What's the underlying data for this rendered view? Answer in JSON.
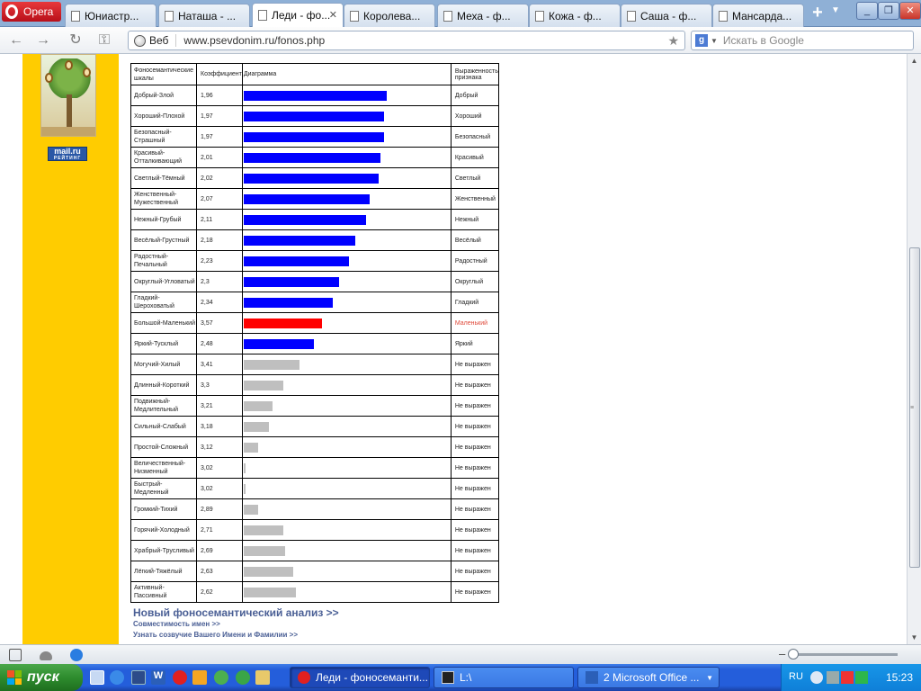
{
  "browser": {
    "menu_label": "Opera",
    "tabs": [
      {
        "title": "Юниастр..."
      },
      {
        "title": "Наташа - ..."
      },
      {
        "title": "Леди - фо..."
      },
      {
        "title": "Королева..."
      },
      {
        "title": "Меха - ф..."
      },
      {
        "title": "Кожа - ф..."
      },
      {
        "title": "Саша - ф..."
      },
      {
        "title": "Мансарда..."
      }
    ],
    "active_tab_index": 2,
    "address": {
      "scope_label": "Веб",
      "url": "www.psevdonim.ru/fonos.php"
    },
    "search": {
      "engine_icon": "g-icon",
      "placeholder": "Искать в Google"
    }
  },
  "sidebar": {
    "badge_top": "mail.ru",
    "badge_bottom": "РЕЙТИНГ"
  },
  "table": {
    "headers": [
      "Фоносемантические шкалы",
      "Коэффициент",
      "Диаграмма",
      "Выраженность признака"
    ],
    "colors": {
      "positive": "#0000ff",
      "negative": "#ff0000",
      "neutral": "#bfbfbf"
    },
    "rows": [
      {
        "scale": "Добрый-Злой",
        "coef": "1,96",
        "bar": 0.69,
        "color": "positive",
        "result": "Добрый"
      },
      {
        "scale": "Хороший-Плохой",
        "coef": "1,97",
        "bar": 0.68,
        "color": "positive",
        "result": "Хороший"
      },
      {
        "scale": "Безопасный-Страшный",
        "coef": "1,97",
        "bar": 0.68,
        "color": "positive",
        "result": "Безопасный"
      },
      {
        "scale": "Красивый-Отталкивающий",
        "coef": "2,01",
        "bar": 0.66,
        "color": "positive",
        "result": "Красивый"
      },
      {
        "scale": "Светлый-Тёмный",
        "coef": "2,02",
        "bar": 0.65,
        "color": "positive",
        "result": "Светлый"
      },
      {
        "scale": "Женственный-Мужественный",
        "coef": "2,07",
        "bar": 0.61,
        "color": "positive",
        "result": "Женственный"
      },
      {
        "scale": "Нежный-Грубый",
        "coef": "2,11",
        "bar": 0.59,
        "color": "positive",
        "result": "Нежный"
      },
      {
        "scale": "Весёлый-Грустный",
        "coef": "2,18",
        "bar": 0.54,
        "color": "positive",
        "result": "Весёлый"
      },
      {
        "scale": "Радостный-Печальный",
        "coef": "2,23",
        "bar": 0.51,
        "color": "positive",
        "result": "Радостный"
      },
      {
        "scale": "Округлый-Угловатый",
        "coef": "2,3",
        "bar": 0.46,
        "color": "positive",
        "result": "Округлый"
      },
      {
        "scale": "Гладкий-Шероховатый",
        "coef": "2,34",
        "bar": 0.43,
        "color": "positive",
        "result": "Гладкий"
      },
      {
        "scale": "Большой-Маленький",
        "coef": "3,57",
        "bar": 0.38,
        "color": "negative",
        "result": "Маленький"
      },
      {
        "scale": "Яркий-Тусклый",
        "coef": "2,48",
        "bar": 0.34,
        "color": "positive",
        "result": "Яркий"
      },
      {
        "scale": "Могучий-Хилый",
        "coef": "3,41",
        "bar": 0.27,
        "color": "neutral",
        "result": "Не выражен"
      },
      {
        "scale": "Длинный-Короткий",
        "coef": "3,3",
        "bar": 0.19,
        "color": "neutral",
        "result": "Не выражен"
      },
      {
        "scale": "Подвижный-Медлительный",
        "coef": "3,21",
        "bar": 0.14,
        "color": "neutral",
        "result": "Не выражен"
      },
      {
        "scale": "Сильный-Слабый",
        "coef": "3,18",
        "bar": 0.12,
        "color": "neutral",
        "result": "Не выражен"
      },
      {
        "scale": "Простой-Сложный",
        "coef": "3,12",
        "bar": 0.07,
        "color": "neutral",
        "result": "Не выражен"
      },
      {
        "scale": "Величественный-Низменный",
        "coef": "3,02",
        "bar": 0.01,
        "color": "neutral",
        "result": "Не выражен"
      },
      {
        "scale": "Быстрый-Медленный",
        "coef": "3,02",
        "bar": 0.01,
        "color": "neutral",
        "result": "Не выражен"
      },
      {
        "scale": "Громкий-Тихий",
        "coef": "2,89",
        "bar": 0.07,
        "color": "neutral",
        "result": "Не выражен"
      },
      {
        "scale": "Горячий-Холодный",
        "coef": "2,71",
        "bar": 0.19,
        "color": "neutral",
        "result": "Не выражен"
      },
      {
        "scale": "Храбрый-Трусливый",
        "coef": "2,69",
        "bar": 0.2,
        "color": "neutral",
        "result": "Не выражен"
      },
      {
        "scale": "Лёгкий-Тяжёлый",
        "coef": "2,63",
        "bar": 0.24,
        "color": "neutral",
        "result": "Не выражен"
      },
      {
        "scale": "Активный-Пассивный",
        "coef": "2,62",
        "bar": 0.25,
        "color": "neutral",
        "result": "Не выражен"
      }
    ]
  },
  "links": {
    "new_analysis": "Новый фоносемантический анализ >>",
    "compatibility": "Совместимость имен >>",
    "name_consonance": "Узнать созвучие Вашего Имени и Фамилии >>"
  },
  "taskbar": {
    "start_label": "пуск",
    "tasks": [
      {
        "label": "Леди - фоносеманти..."
      },
      {
        "label": "L:\\"
      },
      {
        "label": "2 Microsoft Office ..."
      }
    ],
    "tray": {
      "lang": "RU",
      "clock": "15:23"
    }
  }
}
